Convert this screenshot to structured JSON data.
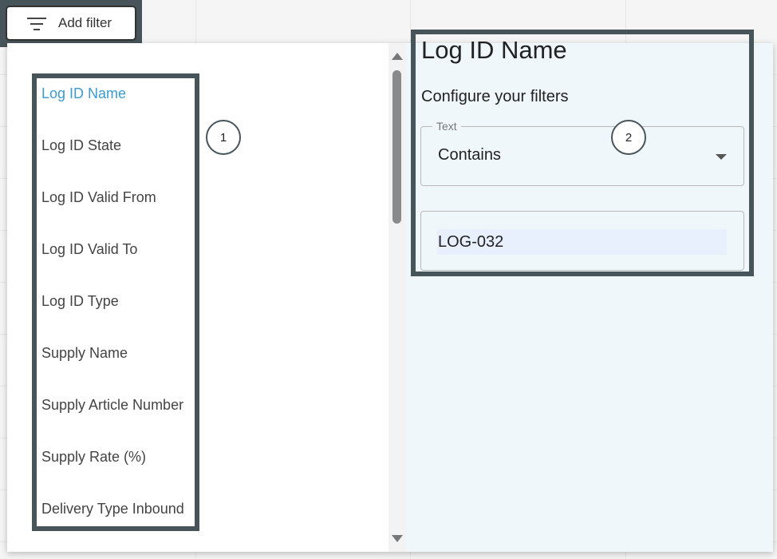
{
  "toolbar": {
    "add_filter_label": "Add filter"
  },
  "fields": [
    {
      "label": "Log ID Name",
      "active": true
    },
    {
      "label": "Log ID State",
      "active": false
    },
    {
      "label": "Log ID Valid From",
      "active": false
    },
    {
      "label": "Log ID Valid To",
      "active": false
    },
    {
      "label": "Log ID Type",
      "active": false
    },
    {
      "label": "Supply Name",
      "active": false
    },
    {
      "label": "Supply Article Number",
      "active": false
    },
    {
      "label": "Supply Rate (%)",
      "active": false
    },
    {
      "label": "Delivery Type Inbound",
      "active": false
    }
  ],
  "callouts": {
    "one": "1",
    "two": "2"
  },
  "config": {
    "title": "Log ID Name",
    "subtitle": "Configure your filters",
    "operator_legend": "Text",
    "operator_value": "Contains",
    "value_input": "LOG-032"
  },
  "colors": {
    "active_field": "#3d9bd0",
    "callout_frame": "#47555a",
    "config_background": "#f0f7fb",
    "input_highlight": "#e8f0fe"
  }
}
